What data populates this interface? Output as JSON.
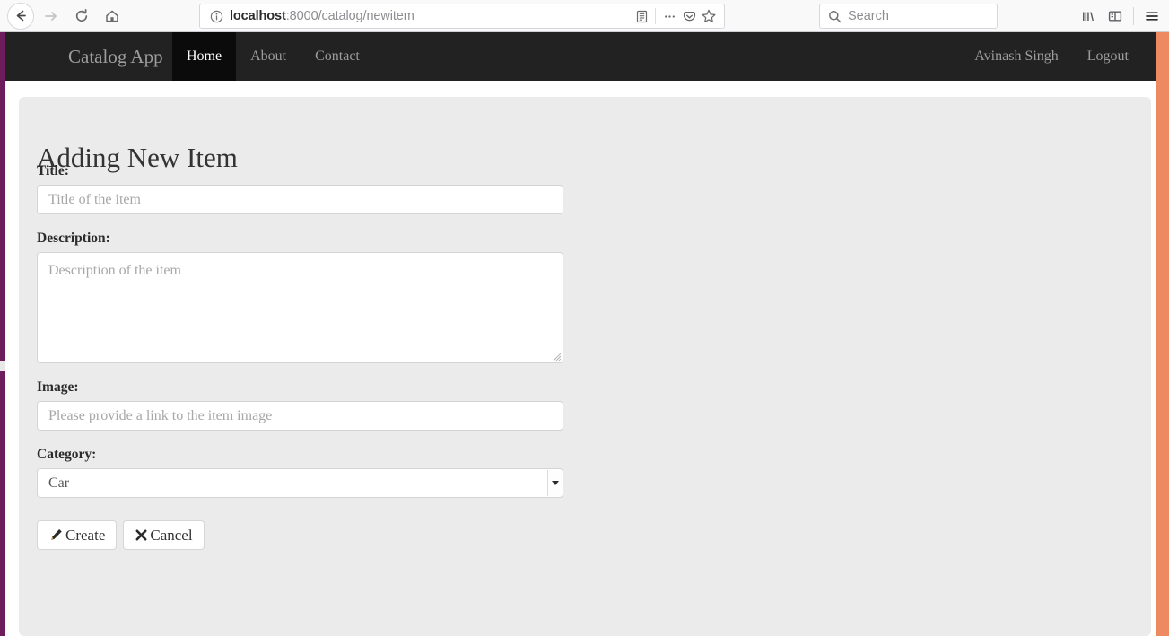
{
  "browser": {
    "back_tooltip": "Back",
    "forward_tooltip": "Forward",
    "reload_tooltip": "Reload",
    "home_tooltip": "Home",
    "url_host": "localhost",
    "url_rest": ":8000/catalog/newitem",
    "search_placeholder": "Search",
    "icons": {
      "back": "back-arrow-icon",
      "forward": "forward-arrow-icon",
      "reload": "reload-icon",
      "home": "home-icon",
      "identity": "info-icon",
      "reader": "reader-mode-icon",
      "page_actions": "ellipsis-icon",
      "pocket": "pocket-icon",
      "bookmark": "star-icon",
      "search": "search-icon",
      "library": "library-icon",
      "sidebar": "sidebar-icon",
      "menu": "hamburger-menu-icon"
    }
  },
  "navbar": {
    "brand": "Catalog App",
    "links": [
      {
        "label": "Home",
        "active": true
      },
      {
        "label": "About",
        "active": false
      },
      {
        "label": "Contact",
        "active": false
      }
    ],
    "user": "Avinash Singh",
    "logout": "Logout",
    "background": "#222222",
    "active_background": "#0b0b0b"
  },
  "main": {
    "title": "Adding New Item",
    "fields": {
      "title": {
        "label": "Title:",
        "value": "",
        "placeholder": "Title of the item"
      },
      "description": {
        "label": "Description:",
        "value": "",
        "placeholder": "Description of the item"
      },
      "image": {
        "label": "Image:",
        "value": "",
        "placeholder": "Please provide a link to the item image"
      },
      "category": {
        "label": "Category:",
        "selected": "Car",
        "options": [
          "Car"
        ]
      }
    },
    "buttons": {
      "create": {
        "label": "Create",
        "icon": "pencil-icon"
      },
      "cancel": {
        "label": "Cancel",
        "icon": "times-icon"
      }
    }
  },
  "colors": {
    "left_stripe": "#6d1d5c",
    "right_scrollbar": "#ee8a62",
    "jumbotron": "#ebebeb",
    "page_background": "#ffffff"
  }
}
